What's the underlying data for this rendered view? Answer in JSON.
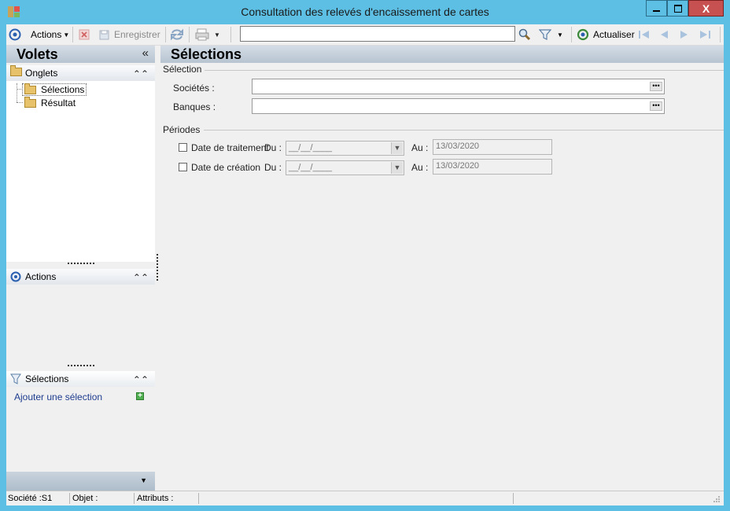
{
  "window": {
    "title": "Consultation des relevés d'encaissement de cartes",
    "minimize_label": "▁",
    "maximize_label": "☐",
    "close_label": "X"
  },
  "toolbar": {
    "actions_label": "Actions",
    "save_label": "Enregistrer",
    "search_value": "",
    "refresh_label": "Actualiser"
  },
  "left": {
    "volets_title": "Volets",
    "volets_chevron": "«",
    "onglets_title": "Onglets",
    "onglets_items": [
      "Sélections",
      "Résultat"
    ],
    "actions_title": "Actions",
    "selections_title": "Sélections",
    "add_selection_link": "Ajouter une sélection",
    "chevron_up": "⌃"
  },
  "main": {
    "title": "Sélections",
    "selection_group": "Sélection",
    "societes_label": "Sociétés :",
    "societes_value": "",
    "banques_label": "Banques :",
    "banques_value": "",
    "periodes_group": "Périodes",
    "rows": [
      {
        "label": "Date de traitement",
        "du_label": "Du :",
        "du_value": "__/__/____",
        "au_label": "Au :",
        "au_value": "13/03/2020",
        "checked": false
      },
      {
        "label": "Date de création",
        "du_label": "Du :",
        "du_value": "__/__/____",
        "au_label": "Au :",
        "au_value": "13/03/2020",
        "checked": false
      }
    ]
  },
  "status": {
    "societe": "Société :S1",
    "objet": "Objet :",
    "attributs": "Attributs :"
  },
  "colors": {
    "frame": "#5dbfe4",
    "header_gradient": "#b7c4d1",
    "link": "#1e3d8f",
    "close": "#c75050"
  }
}
